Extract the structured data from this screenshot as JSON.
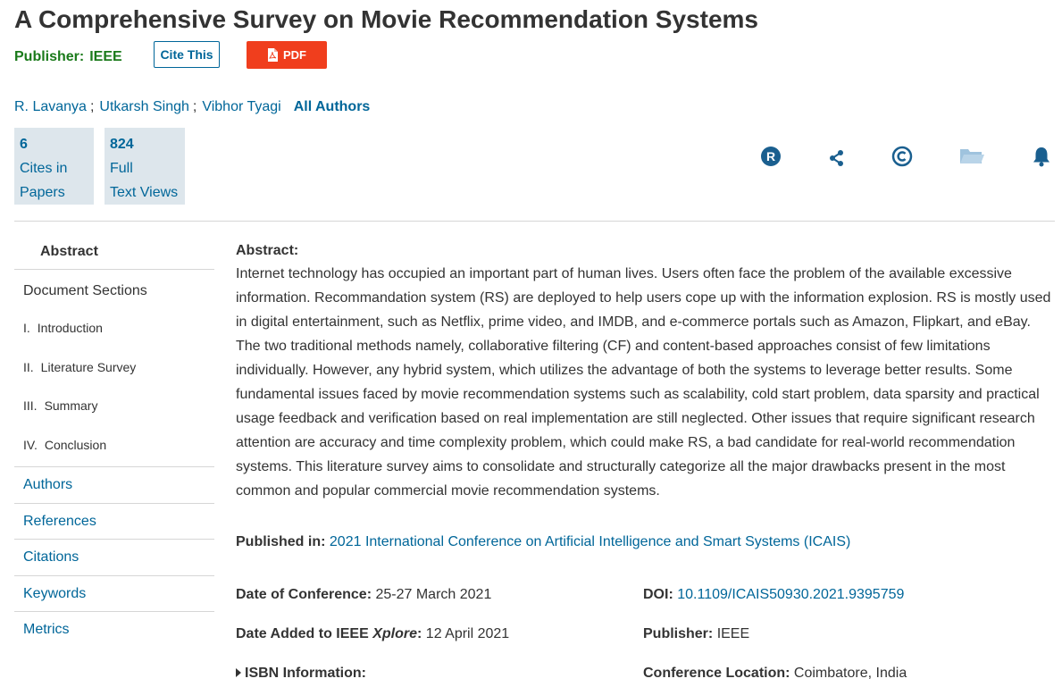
{
  "title": "A Comprehensive Survey on Movie Recommendation Systems",
  "publisher": {
    "label": "Publisher:",
    "value": "IEEE"
  },
  "buttons": {
    "cite": "Cite This",
    "pdf": "PDF"
  },
  "authors": {
    "list": [
      "R. Lavanya",
      "Utkarsh Singh",
      "Vibhor Tyagi"
    ],
    "separator": ";",
    "all_link": "All Authors"
  },
  "metrics": [
    {
      "number": "6",
      "line1": "Cites in",
      "line2": "Papers"
    },
    {
      "number": "824",
      "line1": "Full",
      "line2": "Text Views"
    }
  ],
  "toolbar_icons": [
    "rights-icon",
    "share-icon",
    "copyright-icon",
    "folder-icon",
    "bell-icon"
  ],
  "sidebar": {
    "abstract": "Abstract",
    "doc_sections": "Document Sections",
    "sections": [
      {
        "num": "I.",
        "label": "Introduction"
      },
      {
        "num": "II.",
        "label": "Literature Survey"
      },
      {
        "num": "III.",
        "label": "Summary"
      },
      {
        "num": "IV.",
        "label": "Conclusion"
      }
    ],
    "links": [
      "Authors",
      "References",
      "Citations",
      "Keywords",
      "Metrics"
    ]
  },
  "abstract": {
    "heading": "Abstract:",
    "text": "Internet technology has occupied an important part of human lives. Users often face the problem of the available excessive information. Recommandation system (RS) are deployed to help users cope up with the information explosion. RS is mostly used in digital entertainment, such as Netflix, prime video, and IMDB, and e-commerce portals such as Amazon, Flipkart, and eBay. The two traditional methods namely, collaborative filtering (CF) and content-based approaches consist of few limitations individually. However, any hybrid system, which utilizes the advantage of both the systems to leverage better results. Some fundamental issues faced by movie recommendation systems such as scalability, cold start problem, data sparsity and practical usage feedback and verification based on real implementation are still neglected. Other issues that require significant research attention are accuracy and time complexity problem, which could make RS, a bad candidate for real-world recommendation systems. This literature survey aims to consolidate and structurally categorize all the major drawbacks present in the most common and popular commercial movie recommendation systems."
  },
  "published_in": {
    "label": "Published in:",
    "value": "2021 International Conference on Artificial Intelligence and Smart Systems (ICAIS)"
  },
  "details": {
    "conf_date_label": "Date of Conference:",
    "conf_date": "25-27 March 2021",
    "date_added_label_pre": "Date Added to IEEE",
    "date_added_label_em": "Xplore",
    "date_added_colon": ":",
    "date_added": "12 April 2021",
    "isbn_label": "ISBN Information:",
    "doi_label": "DOI:",
    "doi": "10.1109/ICAIS50930.2021.9395759",
    "publisher_label": "Publisher:",
    "publisher": "IEEE",
    "location_label": "Conference Location:",
    "location": "Coimbatore, India"
  },
  "colors": {
    "link": "#006699",
    "pdf_button": "#f03e1d",
    "publisher_green": "#1a7a1a",
    "metric_bg": "#dde6ec"
  }
}
